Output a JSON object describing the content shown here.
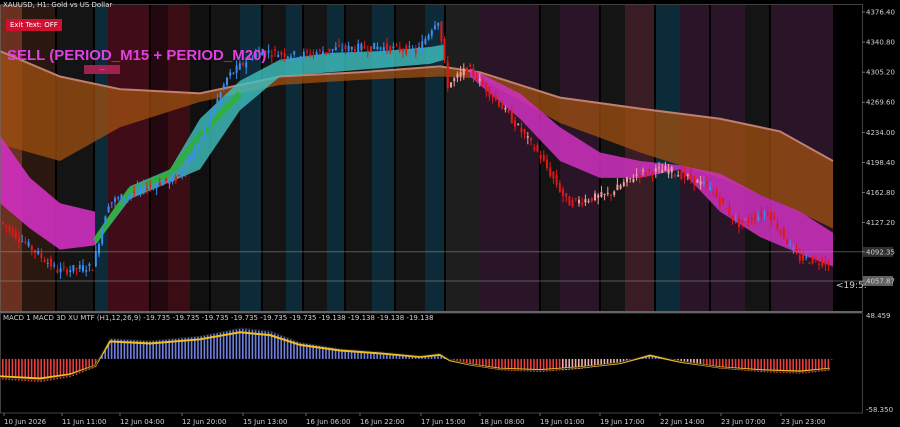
{
  "window": {
    "symbol_title": "XAUUSD, H1:  Gold vs US Dollar",
    "exit_button": "Exit Text: OFF",
    "signal_label": "SELL (PERIOD_M15 + PERIOD_M20)",
    "signal_tag": "—",
    "timer": "<19:5:"
  },
  "price_axis": {
    "ticks": [
      "4376.40",
      "4340.80",
      "4305.20",
      "4269.60",
      "4234.00",
      "4198.40",
      "4162.80",
      "4127.20",
      "4092.35",
      "4057.87"
    ],
    "highlight_labels": [
      "4092.35",
      "4057.87"
    ]
  },
  "macd_panel": {
    "label": "MACD 1 MACD 3D XU MTF (H1,12,26,9) -19.735 -19.735 -19.735 -19.735 -19.735 -19.735 -19.138 -19.138 -19.138 -19.138",
    "axis_top": "48.459",
    "axis_bottom": "-58.350"
  },
  "time_axis": {
    "labels": [
      "10 Jun 2026",
      "11 Jun 11:00",
      "12 Jun 04:00",
      "12 Jun 20:00",
      "15 Jun 13:00",
      "16 Jun 06:00",
      "16 Jun 22:00",
      "17 Jun 15:00",
      "18 Jun 08:00",
      "19 Jun 01:00",
      "19 Jun 17:00",
      "22 Jun 14:00",
      "23 Jun 07:00",
      "23 Jun 23:00"
    ]
  },
  "colors": {
    "bull_candle": "#3a8ef0",
    "bear_candle": "#e01818",
    "macd_signal": "#f0c020",
    "macd_hist_pos": "#7080e0",
    "macd_hist_neg": "#e84040",
    "band_magenta": "#d030c0",
    "band_orange": "#a05010",
    "band_teal": "#40c0c0",
    "band_green": "#30b030"
  },
  "chart_data": {
    "type": "line",
    "title": "XAUUSD, H1:  Gold vs US Dollar",
    "ylim": [
      4040,
      4385
    ],
    "x": [
      "10 Jun 2026",
      "11 Jun 11:00",
      "12 Jun 04:00",
      "12 Jun 20:00",
      "15 Jun 13:00",
      "16 Jun 06:00",
      "16 Jun 22:00",
      "17 Jun 15:00",
      "18 Jun 08:00",
      "19 Jun 01:00",
      "19 Jun 17:00",
      "22 Jun 14:00",
      "23 Jun 07:00",
      "23 Jun 23:00"
    ],
    "series": [
      {
        "values": [
          4130,
          4070,
          4155,
          4200,
          4315,
          4335,
          4338,
          4340,
          4310,
          4240,
          4140,
          4185,
          4180,
          4120
        ]
      },
      {
        "values": [
          4250,
          4220,
          4205,
          4230,
          4270,
          4300,
          4305,
          4310,
          4305,
          4280,
          4250,
          4230,
          4210,
          4190
        ]
      }
    ]
  }
}
